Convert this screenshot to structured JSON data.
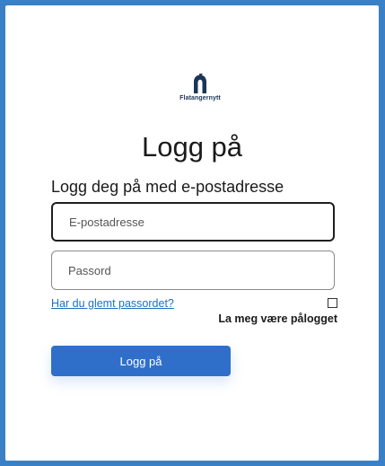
{
  "brand": {
    "name": "Flatangernytt",
    "logo_color": "#1b3558"
  },
  "login": {
    "title": "Logg på",
    "subtitle": "Logg deg på med e-postadresse",
    "email_placeholder": "E-postadresse",
    "email_value": "",
    "password_placeholder": "Passord",
    "password_value": "",
    "forgot_password_label": "Har du glemt passordet?",
    "remember_me_label": "La meg være pålogget",
    "remember_me_checked": false,
    "submit_label": "Logg på"
  },
  "colors": {
    "background": "#3a80c6",
    "accent": "#2f6fc9",
    "link": "#1f6fc4"
  }
}
